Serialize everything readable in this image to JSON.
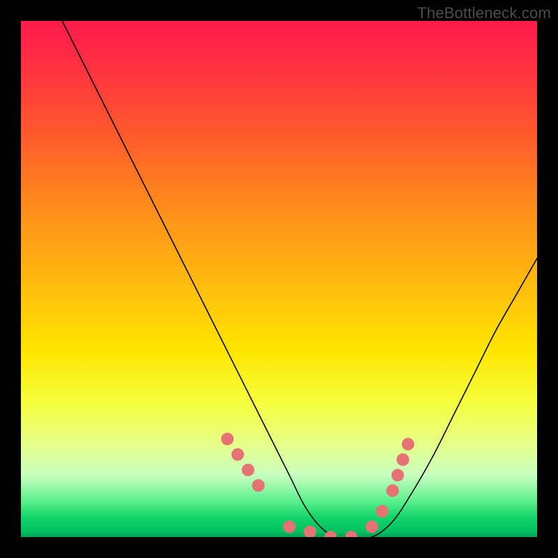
{
  "watermark": "TheBottleneck.com",
  "colors": {
    "background": "#000000",
    "curve_stroke": "#000000",
    "dot_fill": "#e57373",
    "gradient_top": "#ff1a4e",
    "gradient_bottom": "#009e53"
  },
  "chart_data": {
    "type": "line",
    "title": "",
    "xlabel": "",
    "ylabel": "",
    "xlim": [
      0,
      100
    ],
    "ylim": [
      0,
      100
    ],
    "series": [
      {
        "name": "curve",
        "x": [
          8,
          12,
          16,
          20,
          24,
          28,
          32,
          36,
          40,
          44,
          48,
          52,
          55,
          58,
          61,
          64,
          68,
          72,
          76,
          80,
          84,
          88,
          92,
          96,
          100
        ],
        "y": [
          100,
          92,
          84,
          76,
          68,
          60,
          52,
          44,
          36,
          28,
          20,
          12,
          6,
          2,
          0,
          0,
          0,
          3,
          9,
          16,
          24,
          32,
          40,
          47,
          54
        ]
      }
    ],
    "highlight_dots": {
      "name": "dots",
      "x": [
        40,
        42,
        44,
        46,
        52,
        56,
        60,
        64,
        68,
        70,
        72,
        73,
        74,
        75
      ],
      "y": [
        19,
        16,
        13,
        10,
        2,
        1,
        0,
        0,
        2,
        5,
        9,
        12,
        15,
        18
      ]
    }
  }
}
